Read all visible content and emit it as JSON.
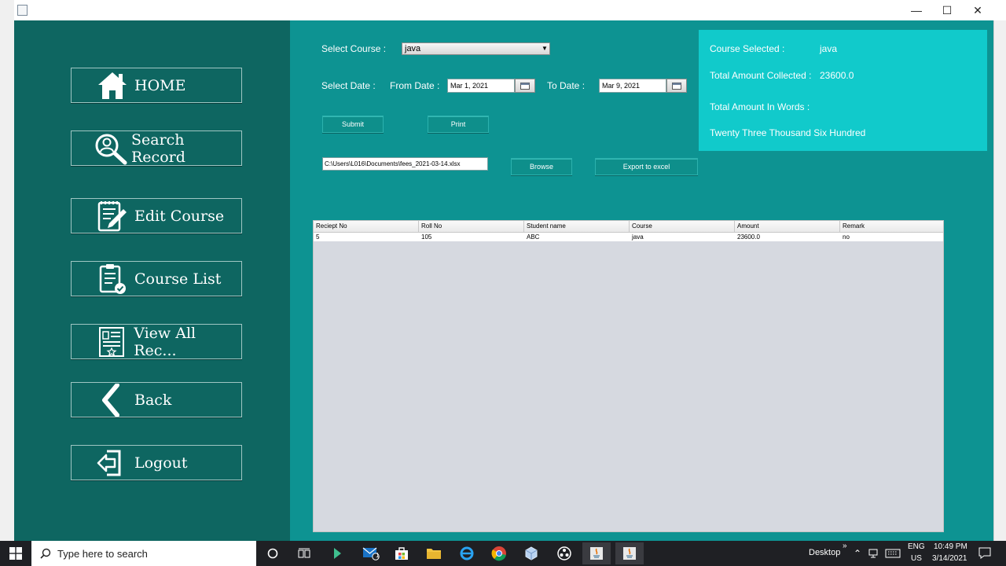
{
  "window": {
    "minimize": "—",
    "maximize": "☐",
    "close": "✕"
  },
  "colors": {
    "sidebar": "#0e6661",
    "main": "#0d9392",
    "summary": "#11cacb"
  },
  "sidebar": {
    "items": [
      {
        "label": "HOME",
        "icon": "home-icon"
      },
      {
        "label": "Search Record",
        "icon": "search-user-icon"
      },
      {
        "label": "Edit Course",
        "icon": "edit-document-icon"
      },
      {
        "label": "Course List",
        "icon": "clipboard-check-icon"
      },
      {
        "label": "View All Rec...",
        "icon": "certificate-icon"
      },
      {
        "label": "Back",
        "icon": "chevron-left-icon"
      },
      {
        "label": "Logout",
        "icon": "logout-arrow-icon"
      }
    ]
  },
  "form": {
    "select_course_label": "Select Course :",
    "course_value": "java",
    "select_date_label": "Select Date :",
    "from_date_label": "From Date :",
    "from_date_value": "Mar 1, 2021",
    "to_date_label": "To Date :",
    "to_date_value": "Mar 9, 2021",
    "submit_label": "Submit",
    "print_label": "Print",
    "path_value": "C:\\Users\\L016\\Documents\\fees_2021-03-14.xlsx",
    "browse_label": "Browse",
    "export_label": "Export to excel"
  },
  "summary": {
    "course_selected_label": "Course Selected :",
    "course_selected_value": "java",
    "total_collected_label": "Total Amount Collected :",
    "total_collected_value": "23600.0",
    "total_words_label": "Total Amount In Words :",
    "total_words_value": "Twenty Three Thousand Six Hundred"
  },
  "table": {
    "columns": [
      "Reciept No",
      "Roll No",
      "Student name",
      "Course",
      "Amount",
      "Remark"
    ],
    "rows": [
      [
        "5",
        "105",
        "ABC",
        "java",
        "23600.0",
        "no"
      ]
    ]
  },
  "taskbar": {
    "search_placeholder": "Type here to search",
    "desktop_label": "Desktop",
    "chevron": "»",
    "lang_line1": "ENG",
    "lang_line2": "US",
    "time": "10:49 PM",
    "date": "3/14/2021",
    "mail_badge": "1"
  }
}
